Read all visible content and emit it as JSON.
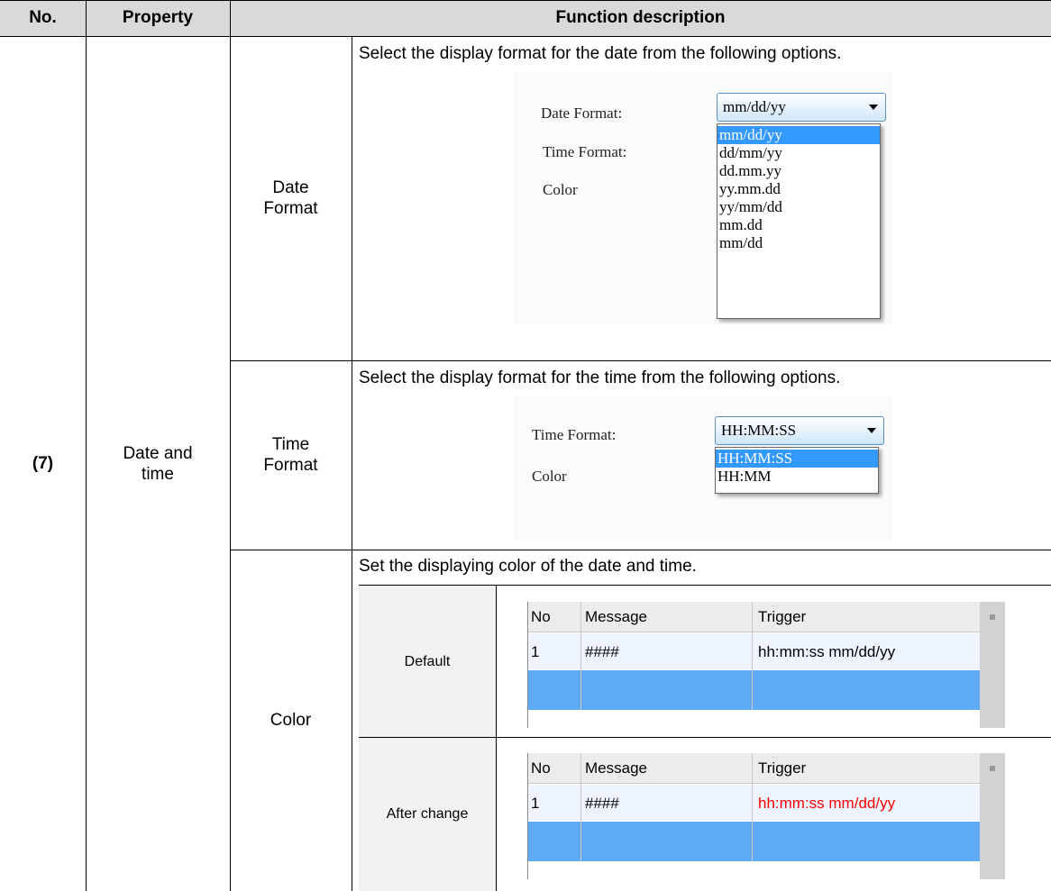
{
  "header": {
    "no": "No.",
    "property": "Property",
    "function": "Function description"
  },
  "row": {
    "no": "(7)",
    "property": "Date and time"
  },
  "date_format": {
    "label": "Date Format",
    "description": "Select the display format for the date from the following options.",
    "dialog": {
      "date_label": "Date Format:",
      "time_label": "Time Format:",
      "color_label": "Color",
      "selected": "mm/dd/yy",
      "options": [
        "mm/dd/yy",
        "dd/mm/yy",
        "dd.mm.yy",
        "yy.mm.dd",
        "yy/mm/dd",
        "mm.dd",
        "mm/dd"
      ]
    }
  },
  "time_format": {
    "label": "Time Format",
    "description": "Select the display format for the time from the following options.",
    "dialog": {
      "time_label": "Time Format:",
      "color_label": "Color",
      "selected": "HH:MM:SS",
      "options": [
        "HH:MM:SS",
        "HH:MM"
      ]
    }
  },
  "color": {
    "label": "Color",
    "description": "Set the displaying color of the date and time.",
    "columns": [
      "No",
      "Message",
      "Trigger"
    ],
    "default": {
      "label": "Default",
      "row": [
        "1",
        "####",
        "hh:mm:ss mm/dd/yy"
      ],
      "trigger_color": "#000000"
    },
    "after": {
      "label": "After change",
      "row": [
        "1",
        "####",
        "hh:mm:ss mm/dd/yy"
      ],
      "trigger_color": "#ff0000"
    }
  },
  "colors": {
    "header_bg": "#d9d9d9",
    "selection": "#3399ff",
    "grid_row_selected": "#5eaaf7",
    "grid_header_bg": "#ececec"
  }
}
